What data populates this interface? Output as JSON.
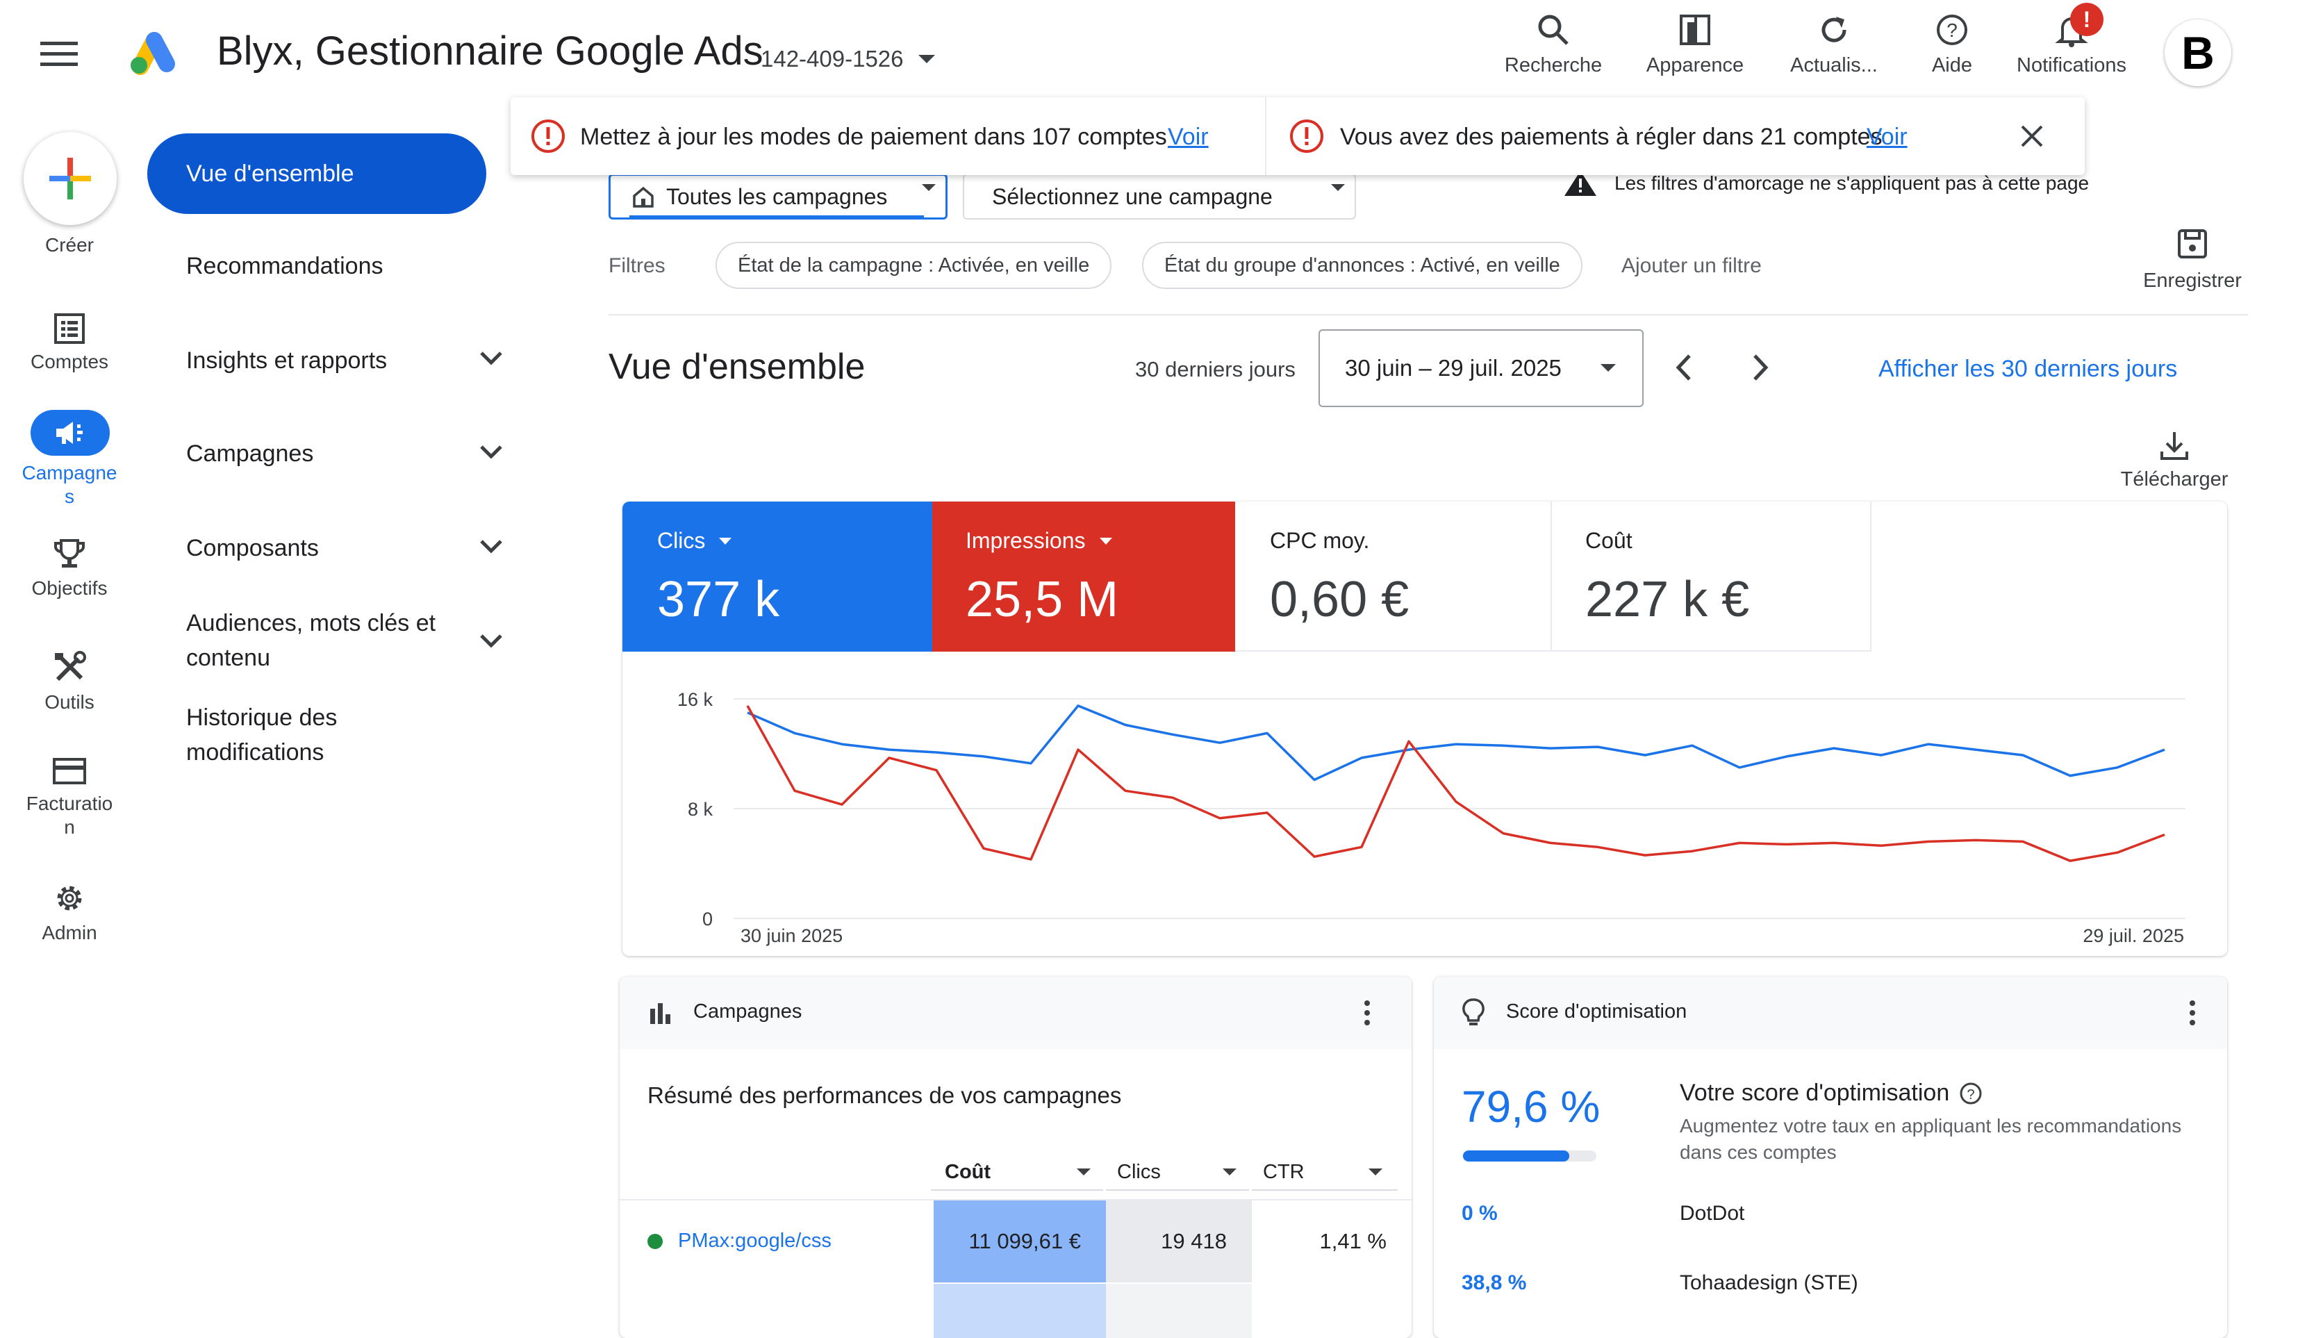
{
  "header": {
    "title": "Blyx, Gestionnaire Google Ads",
    "account_id": "142-409-1526",
    "nav": [
      "Recherche",
      "Apparence",
      "Actualis...",
      "Aide",
      "Notifications"
    ],
    "notification_badge": "!",
    "avatar_letter": "B"
  },
  "rail": {
    "create": "Créer",
    "items": [
      "Comptes",
      "Campagne\ns",
      "Objectifs",
      "Outils",
      "Facturatio\nn",
      "Admin"
    ]
  },
  "menu": {
    "overview": "Vue d'ensemble",
    "items": [
      "Recommandations",
      "Insights et rapports",
      "Campagnes",
      "Composants",
      "Audiences, mots clés et\ncontenu",
      "Historique des\nmodifications"
    ]
  },
  "banner": {
    "msg1": "Mettez à jour les modes de paiement dans 107 comptes",
    "msg2": "Vous avez des paiements à régler dans 21 comptes",
    "link": "Voir"
  },
  "filters": {
    "all_campaigns": "Toutes les campagnes",
    "select_campaign": "Sélectionnez une campagne",
    "warning": "Les filtres d'amorcage ne s'appliquent pas à cette page",
    "label": "Filtres",
    "chip1": "État de la campagne : Activée, en veille",
    "chip2": "État du groupe d'annonces : Activé, en veille",
    "add": "Ajouter un filtre",
    "save": "Enregistrer"
  },
  "overview": {
    "title": "Vue d'ensemble",
    "range_label": "30 derniers jours",
    "range": "30 juin – 29 juil. 2025",
    "show_link": "Afficher les 30 derniers jours",
    "download": "Télécharger"
  },
  "metrics": [
    {
      "label": "Clics",
      "value": "377 k",
      "color": "#1a73e8"
    },
    {
      "label": "Impressions",
      "value": "25,5 M",
      "color": "#d93025"
    },
    {
      "label": "CPC moy.",
      "value": "0,60 €",
      "color": "#ffffff"
    },
    {
      "label": "Coût",
      "value": "227 k €",
      "color": "#ffffff"
    }
  ],
  "chart_data": {
    "type": "line",
    "x_start": "30 juin 2025",
    "x_end": "29 juil. 2025",
    "y_ticks": [
      "16 k",
      "8 k",
      "0"
    ],
    "ylim": [
      0,
      16000
    ],
    "series": [
      {
        "color": "#1a73e8",
        "values": [
          15000,
          13500,
          12700,
          12300,
          12100,
          11800,
          11300,
          15500,
          14100,
          13400,
          12800,
          13500,
          10100,
          11700,
          12300,
          12700,
          12600,
          12400,
          12500,
          11900,
          12600,
          11000,
          11800,
          12400,
          11900,
          12700,
          12300,
          11900,
          10400,
          11000,
          12300
        ]
      },
      {
        "color": "#d93025",
        "values": [
          15500,
          9300,
          8300,
          11700,
          10800,
          5100,
          4300,
          12300,
          9300,
          8800,
          7300,
          7700,
          4500,
          5200,
          12900,
          8500,
          6200,
          5500,
          5200,
          4600,
          4900,
          5500,
          5400,
          5500,
          5300,
          5600,
          5700,
          5600,
          4200,
          4800,
          6100
        ]
      }
    ]
  },
  "campaigns_card": {
    "title": "Campagnes",
    "subtitle": "Résumé des performances de vos campagnes",
    "columns": [
      "Coût",
      "Clics",
      "CTR"
    ],
    "rows": [
      {
        "name": "PMax:google/css",
        "cost": "11 099,61 €",
        "clicks": "19 418",
        "ctr": "1,41 %"
      }
    ]
  },
  "optimization_card": {
    "title": "Score d'optimisation",
    "score": "79,6 %",
    "score_value": 79.6,
    "heading": "Votre score d'optimisation",
    "desc": "Augmentez votre taux en appliquant les recommandations\ndans ces comptes",
    "rows": [
      {
        "pct": "0 %",
        "name": "DotDot"
      },
      {
        "pct": "38,8 %",
        "name": "Tohaadesign (STE)"
      }
    ]
  }
}
